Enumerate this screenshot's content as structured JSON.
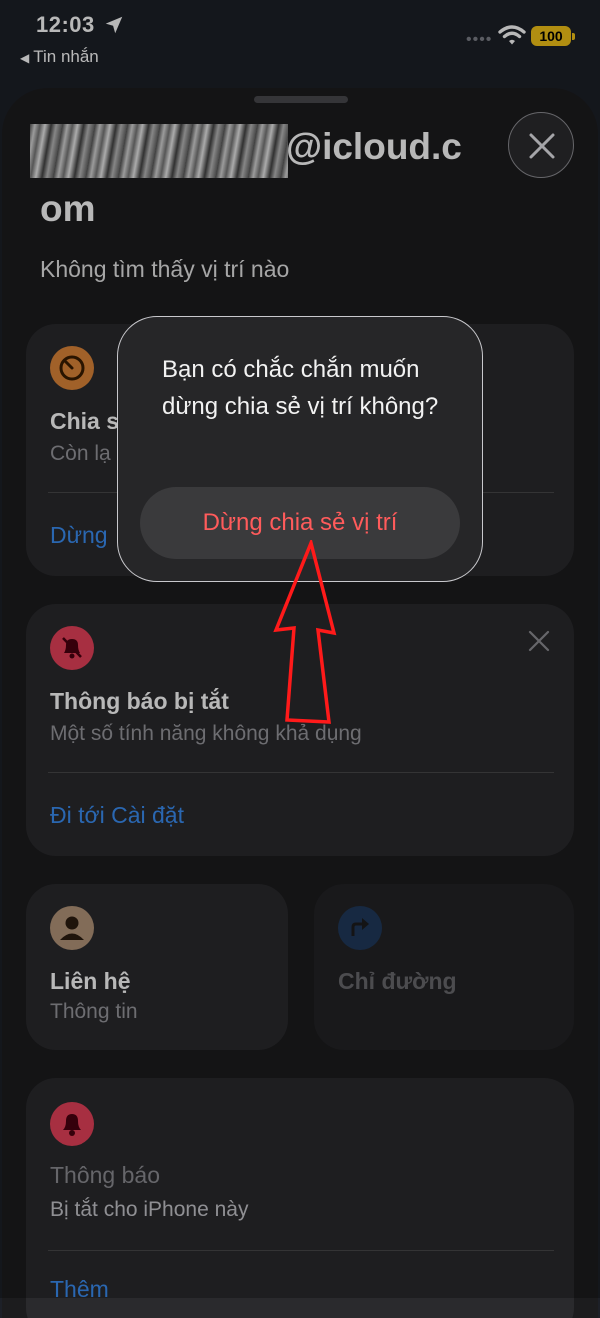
{
  "status_bar": {
    "time": "12:03",
    "back_label": "Tin nhắn",
    "battery": "100"
  },
  "header": {
    "email_visible_suffix": "@icloud.c",
    "email_wrap": "om",
    "subtitle": "Không tìm thấy vị trí nào"
  },
  "share_card": {
    "title_visible": "Chia s",
    "sub_visible": "Còn lạ",
    "action_visible": "Dừng"
  },
  "notif_off_card": {
    "title": "Thông báo bị tắt",
    "subtitle": "Một số tính năng không khả dụng",
    "link": "Đi tới Cài đặt"
  },
  "contact_card": {
    "title": "Liên hệ",
    "subtitle": "Thông tin"
  },
  "directions_card": {
    "title": "Chỉ đường"
  },
  "notifications_card": {
    "title": "Thông báo",
    "subtitle": "Bị tắt cho iPhone này",
    "link": "Thêm"
  },
  "dialog": {
    "message": "Bạn có chắc chắn muốn dừng chia sẻ vị trí không?",
    "confirm_label": "Dừng chia sẻ vị trí"
  },
  "colors": {
    "accent_link": "#3b8ff5",
    "destructive": "#ff5b5b",
    "annotation_arrow": "#ff1a1a",
    "battery": "#f5c518"
  }
}
